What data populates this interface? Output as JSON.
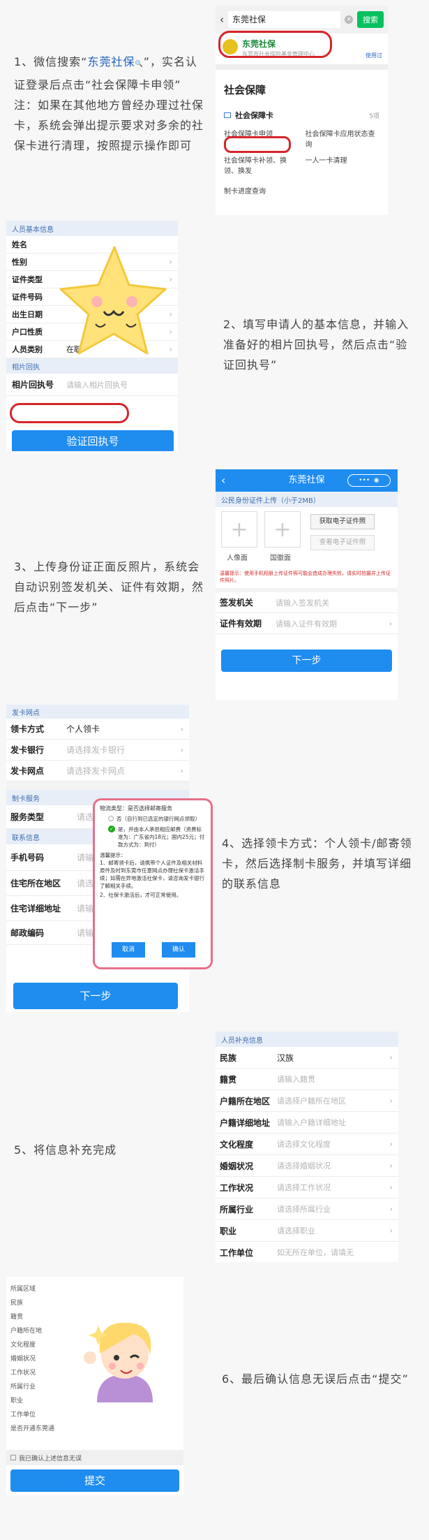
{
  "step1": {
    "text_a": "1、微信搜索“",
    "text_hl": "东莞社保",
    "text_b": "”，实名认证登录后点击“社会保障卡申领”",
    "note": "注：如果在其他地方曾经办理过社保卡，系统会弹出提示要求对多余的社保卡进行清理，按照提示操作即可",
    "search_text": "东莞社保",
    "search_btn": "搜索",
    "result_title": "东莞社保",
    "result_sub": "东莞市社会保险基金管理中心",
    "used": "使用过",
    "section": "社会保障",
    "card_title": "社会保障卡",
    "card_count": "5项",
    "items": [
      "社会保障卡申领",
      "社会保障卡应用状态查询",
      "社会保障卡补领、换领、换发",
      "一人一卡清理",
      "制卡进度查询"
    ]
  },
  "step2": {
    "text": "2、填写申请人的基本信息，并输入准备好的相片回执号，然后点击“验证回执号”",
    "header": "人员基本信息",
    "fields": [
      "姓名",
      "性别",
      "证件类型",
      "证件号码",
      "出生日期",
      "户口性质",
      "人员类别"
    ],
    "status_value": "在职",
    "photo_header": "相片回执",
    "receipt_label": "相片回执号",
    "receipt_ph": "请输入相片回执号",
    "verify_btn": "验证回执号"
  },
  "step3": {
    "text": "3、上传身份证正面反照片，系统会自动识别签发机关、证件有效期，然后点击“下一步”",
    "title": "东莞社保",
    "upload_header": "公民身份证件上传（小于2MB）",
    "front": "人像面",
    "back": "国徽面",
    "get_cert": "获取电子证件照",
    "view_cert": "查看电子证件照",
    "tip": "温馨提示：使用手机相册上传证件照可能会造成办理失败，请实时拍摄并上传证件照片。",
    "issuer_label": "签发机关",
    "issuer_ph": "请输入签发机关",
    "valid_label": "证件有效期",
    "valid_ph": "请输入证件有效期",
    "next": "下一步"
  },
  "step4": {
    "text": "4、选择领卡方式：个人领卡/邮寄领卡，然后选择制卡服务，并填写详细的联系信息",
    "net_header": "发卡网点",
    "method_label": "领卡方式",
    "method_value": "个人领卡",
    "bank_label": "发卡银行",
    "bank_ph": "请选择发卡银行",
    "branch_label": "发卡网点",
    "branch_ph": "请选择发卡网点",
    "make_header": "制卡服务",
    "service_label": "服务类型",
    "service_ph": "请选",
    "contact_header": "联系信息",
    "phone_label": "手机号码",
    "phone_ph": "请输",
    "region_label": "住宅所在地区",
    "region_ph": "请选",
    "addr_label": "住宅详细地址",
    "addr_ph": "请输",
    "zip_label": "邮政编码",
    "zip_ph": "请输",
    "next": "下一步",
    "dialog": {
      "title": "物流类型：是否选择邮寄服务",
      "no": "否（自行到已选定的银行网点领取）",
      "yes": "是，并由本人承担相应邮费（资费标准为：广东省内18元；国内25元；付款方式为：到付）",
      "tip_title": "温馨提示：",
      "tip1": "1、邮寄领卡后，请携带个人证件及相关材料原件及时到东莞市任意网点办理社保卡激活手续；如需在异地激活社保卡，请咨询发卡银行了解相关手续。",
      "tip2": "2、社保卡激活后，才可正常使用。",
      "cancel": "取消",
      "confirm": "确认"
    }
  },
  "step5": {
    "text": "5、将信息补充完成",
    "header": "人员补充信息",
    "rows": [
      {
        "label": "民族",
        "value": "汉族",
        "ph": ""
      },
      {
        "label": "籍贯",
        "value": "",
        "ph": "请输入籍贯"
      },
      {
        "label": "户籍所在地区",
        "value": "",
        "ph": "请选择户籍所在地区"
      },
      {
        "label": "户籍详细地址",
        "value": "",
        "ph": "请输入户籍详细地址"
      },
      {
        "label": "文化程度",
        "value": "",
        "ph": "请选择文化程度"
      },
      {
        "label": "婚姻状况",
        "value": "",
        "ph": "请选择婚姻状况"
      },
      {
        "label": "工作状况",
        "value": "",
        "ph": "请选择工作状况"
      },
      {
        "label": "所属行业",
        "value": "",
        "ph": "请选择所属行业"
      },
      {
        "label": "职业",
        "value": "",
        "ph": "请选择职业"
      },
      {
        "label": "工作单位",
        "value": "",
        "ph": "如无所在单位，请填无"
      }
    ]
  },
  "step6": {
    "text": "6、最后确认信息无误后点击“提交”",
    "items": [
      "所属区域",
      "民族",
      "籍贯",
      "户籍所在地",
      "文化程度",
      "婚姻状况",
      "工作状况",
      "所属行业",
      "职业",
      "工作单位",
      "是否开通东莞通"
    ],
    "confirm": "我已确认上述信息无误",
    "submit": "提交"
  }
}
